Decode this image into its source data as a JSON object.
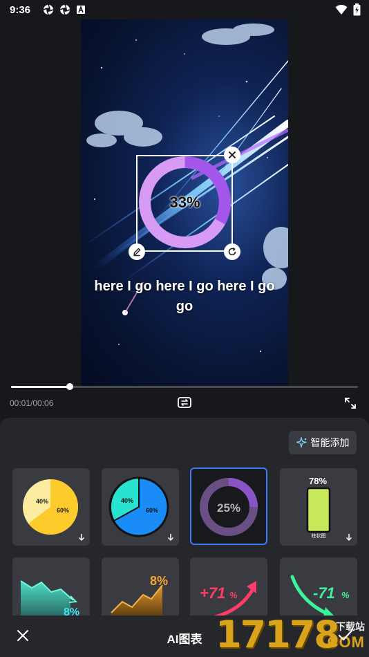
{
  "status_bar": {
    "time": "9:36",
    "left_icons": [
      "aperture-icon",
      "aperture-icon",
      "app-a-icon"
    ],
    "right_icons": [
      "wifi-icon",
      "battery-charging-icon"
    ]
  },
  "preview": {
    "chart_percent_label": "33%",
    "chart_percent_value": 33,
    "subtitle": "here I go here I go here I go go",
    "handles": [
      "close-icon",
      "edit-icon",
      "rotate-icon"
    ]
  },
  "playback": {
    "current_time": "00:01/00:06",
    "progress_fraction": 0.17
  },
  "panel": {
    "smart_add_label": "智能添加",
    "templates": [
      {
        "name": "pie-yellow",
        "labels": [
          "40%",
          "60%"
        ]
      },
      {
        "name": "pie-blue",
        "labels": [
          "40%",
          "60%"
        ]
      },
      {
        "name": "donut-purple",
        "labels": [
          "25%"
        ],
        "selected": true
      },
      {
        "name": "bar-battery",
        "labels": [
          "78%",
          "柱状图"
        ]
      },
      {
        "name": "area-down",
        "labels": [
          "8%"
        ]
      },
      {
        "name": "area-up",
        "labels": [
          "8%"
        ]
      },
      {
        "name": "arrow-up",
        "labels": [
          "+71",
          "%"
        ]
      },
      {
        "name": "arrow-down",
        "labels": [
          "-71",
          "%"
        ]
      }
    ]
  },
  "bottom_bar": {
    "title": "AI图表"
  },
  "watermark": {
    "big": "17178",
    "small": "下载站",
    "com": ".COM"
  },
  "colors": {
    "accent_blue": "#3d7cf5",
    "donut_purple": "#d79bf5",
    "panel_bg": "#26272b",
    "card_bg": "#3a3b40"
  }
}
